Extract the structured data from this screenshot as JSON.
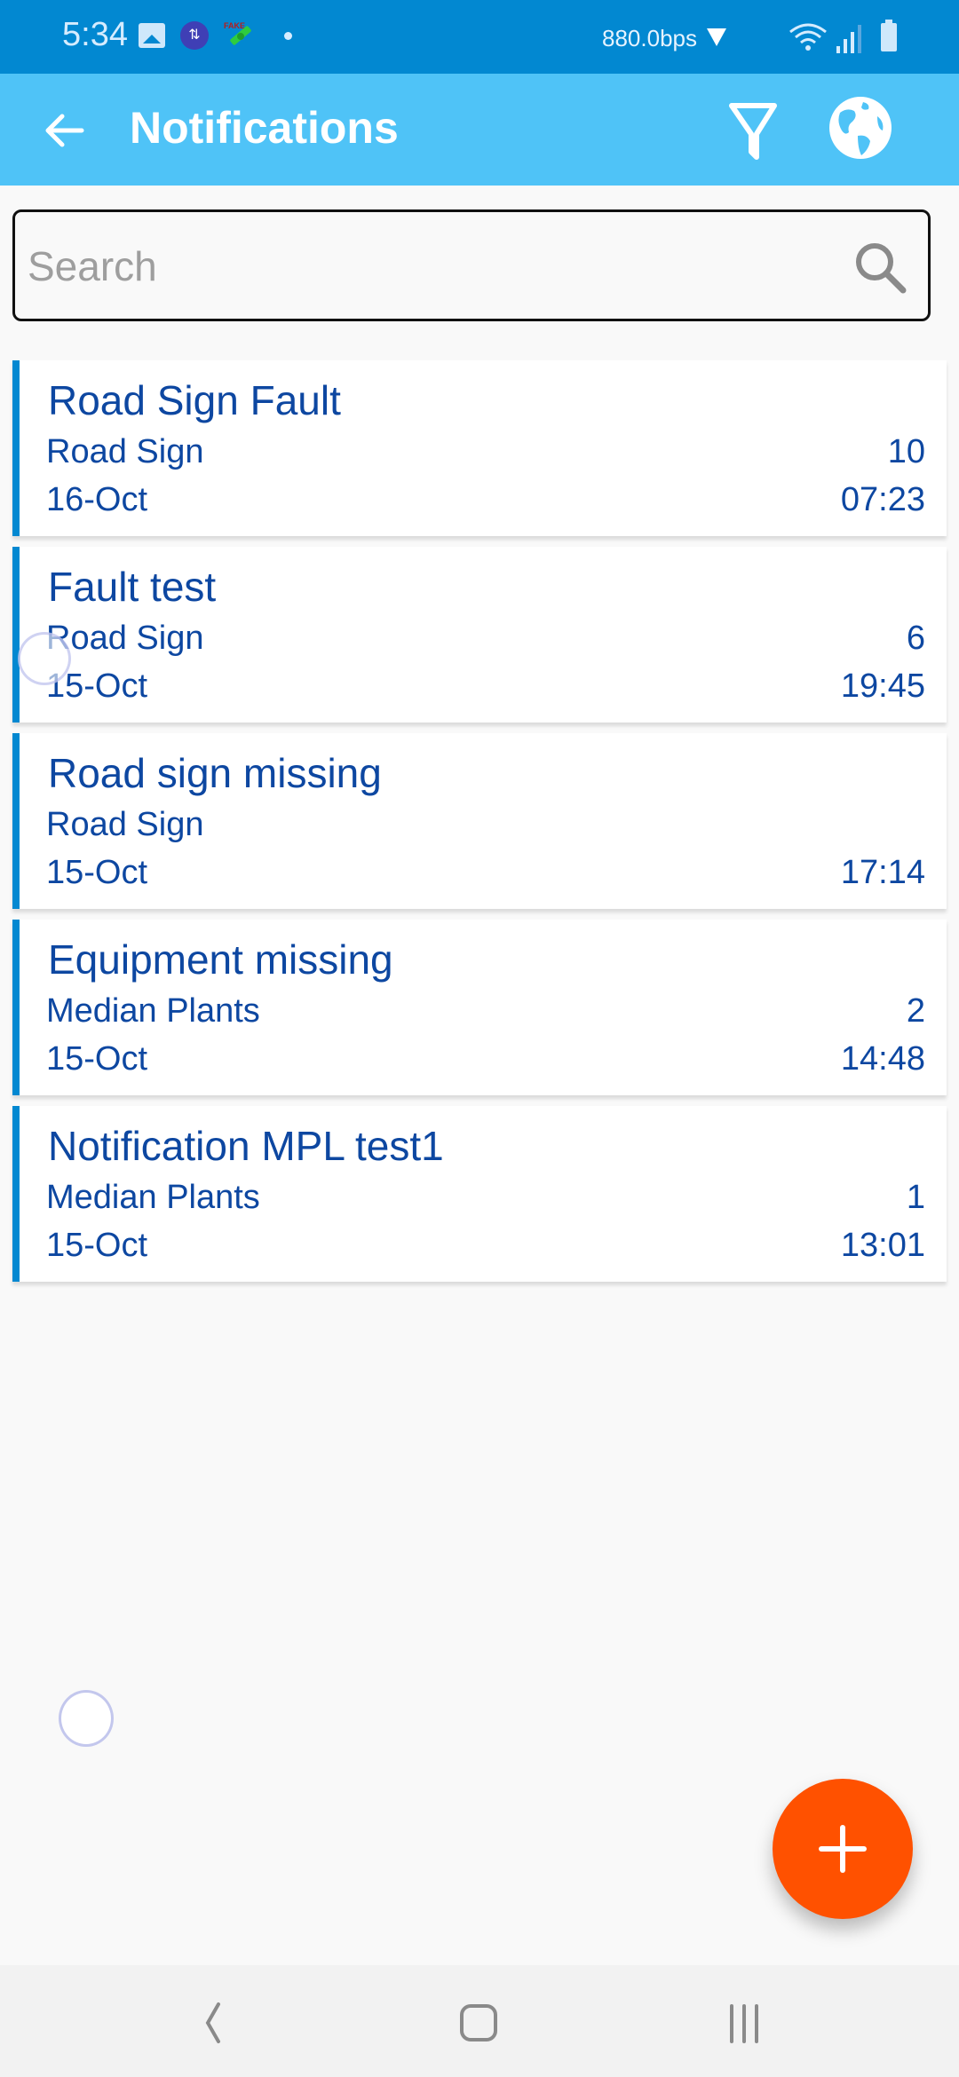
{
  "status_bar": {
    "time": "5:34",
    "network_speed": "880.0bps",
    "icons": [
      "gallery-icon",
      "data-sync-icon",
      "fake-gps-icon",
      "notification-dot-icon",
      "download-arrow-icon",
      "wifi-icon",
      "cell-signal-icon",
      "battery-icon"
    ],
    "fake_label": "FAKE",
    "data_glyph": "⇅"
  },
  "app_bar": {
    "title": "Notifications",
    "back_icon": "arrow-left-icon",
    "actions": [
      {
        "name": "filter",
        "icon": "filter-icon"
      },
      {
        "name": "map",
        "icon": "globe-icon"
      }
    ],
    "color": "#4fc3f7"
  },
  "search": {
    "placeholder": "Search",
    "value": ""
  },
  "notifications": [
    {
      "title": "Road Sign Fault",
      "category": "Road Sign",
      "count": "10",
      "date": "16-Oct",
      "time": "07:23"
    },
    {
      "title": "Fault test",
      "category": "Road Sign",
      "count": "6",
      "date": "15-Oct",
      "time": "19:45"
    },
    {
      "title": "Road sign missing",
      "category": "Road Sign",
      "count": "",
      "date": "15-Oct",
      "time": "17:14"
    },
    {
      "title": "Equipment missing",
      "category": "Median Plants",
      "count": "2",
      "date": "15-Oct",
      "time": "14:48"
    },
    {
      "title": "Notification MPL test1",
      "category": "Median Plants",
      "count": "1",
      "date": "15-Oct",
      "time": "13:01"
    }
  ],
  "fab": {
    "icon": "plus-icon",
    "color": "#ff5100"
  },
  "colors": {
    "status_bar": "#0288d1",
    "card_accent": "#0288d1",
    "card_text": "#0d47a1"
  },
  "nav_bar": {
    "buttons": [
      "back",
      "home",
      "recent-apps"
    ]
  }
}
